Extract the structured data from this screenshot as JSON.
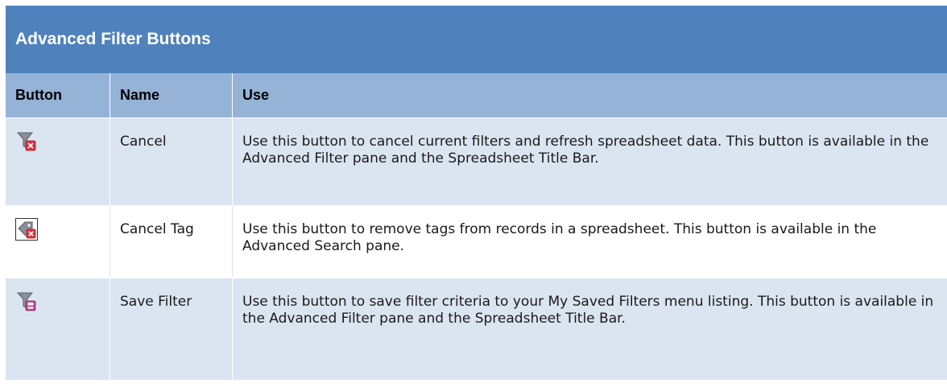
{
  "title": "Advanced Filter Buttons",
  "columns": [
    "Button",
    "Name",
    "Use"
  ],
  "rows": [
    {
      "icon": "cancel-filter-icon",
      "name": "Cancel",
      "use": "Use this button to cancel current filters and refresh spreadsheet data. This button is available in the Advanced Filter pane and the Spreadsheet Title Bar."
    },
    {
      "icon": "cancel-tag-icon",
      "name": "Cancel Tag",
      "use": "Use this button to remove tags from records in a spreadsheet. This button is available in the Advanced Search pane."
    },
    {
      "icon": "save-filter-icon",
      "name": "Save Filter",
      "use": "Use this button to save filter criteria to your My Saved Filters menu listing. This button is available in the Advanced Filter pane and the Spreadsheet Title Bar."
    }
  ],
  "colors": {
    "title_bg": "#4f81bd",
    "header_bg": "#95b3d7",
    "band_bg": "#dbe5f1",
    "cancel_badge": "#e03040",
    "save_badge": "#c04090"
  }
}
